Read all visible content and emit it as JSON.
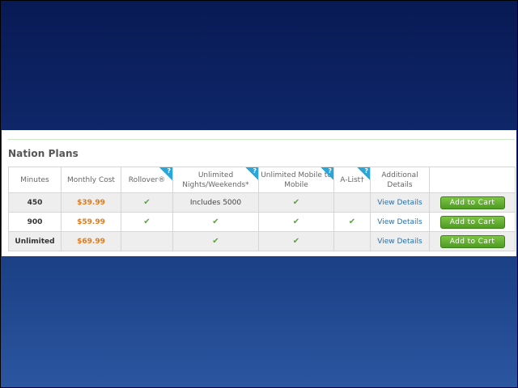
{
  "section": {
    "title": "Nation Plans"
  },
  "columns": [
    {
      "label": "Minutes",
      "help": false
    },
    {
      "label": "Monthly Cost",
      "help": false
    },
    {
      "label": "Rollover®",
      "help": true
    },
    {
      "label": "Unlimited Nights/Weekends*",
      "help": true
    },
    {
      "label": "Unlimited Mobile to Mobile",
      "help": true
    },
    {
      "label": "A-List†",
      "help": true
    },
    {
      "label": "Additional Details",
      "help": false
    },
    {
      "label": "",
      "help": false
    }
  ],
  "help_glyph": "?",
  "check_glyph": "✔",
  "rows": [
    {
      "minutes": "450",
      "cost": "$39.99",
      "rollover": true,
      "nights": "Includes 5000",
      "nights_check": false,
      "mobile": true,
      "alist": false,
      "details": "View Details",
      "cart": "Add to Cart"
    },
    {
      "minutes": "900",
      "cost": "$59.99",
      "rollover": true,
      "nights": "",
      "nights_check": true,
      "mobile": true,
      "alist": true,
      "details": "View Details",
      "cart": "Add to Cart"
    },
    {
      "minutes": "Unlimited",
      "cost": "$69.99",
      "rollover": false,
      "nights": "",
      "nights_check": true,
      "mobile": true,
      "alist": false,
      "details": "View Details",
      "cart": "Add to Cart"
    }
  ],
  "colors": {
    "price": "#e07b1d",
    "check": "#58a83b",
    "link": "#2a6ea9",
    "button": "#5aa82b",
    "help": "#2aa6d8"
  }
}
